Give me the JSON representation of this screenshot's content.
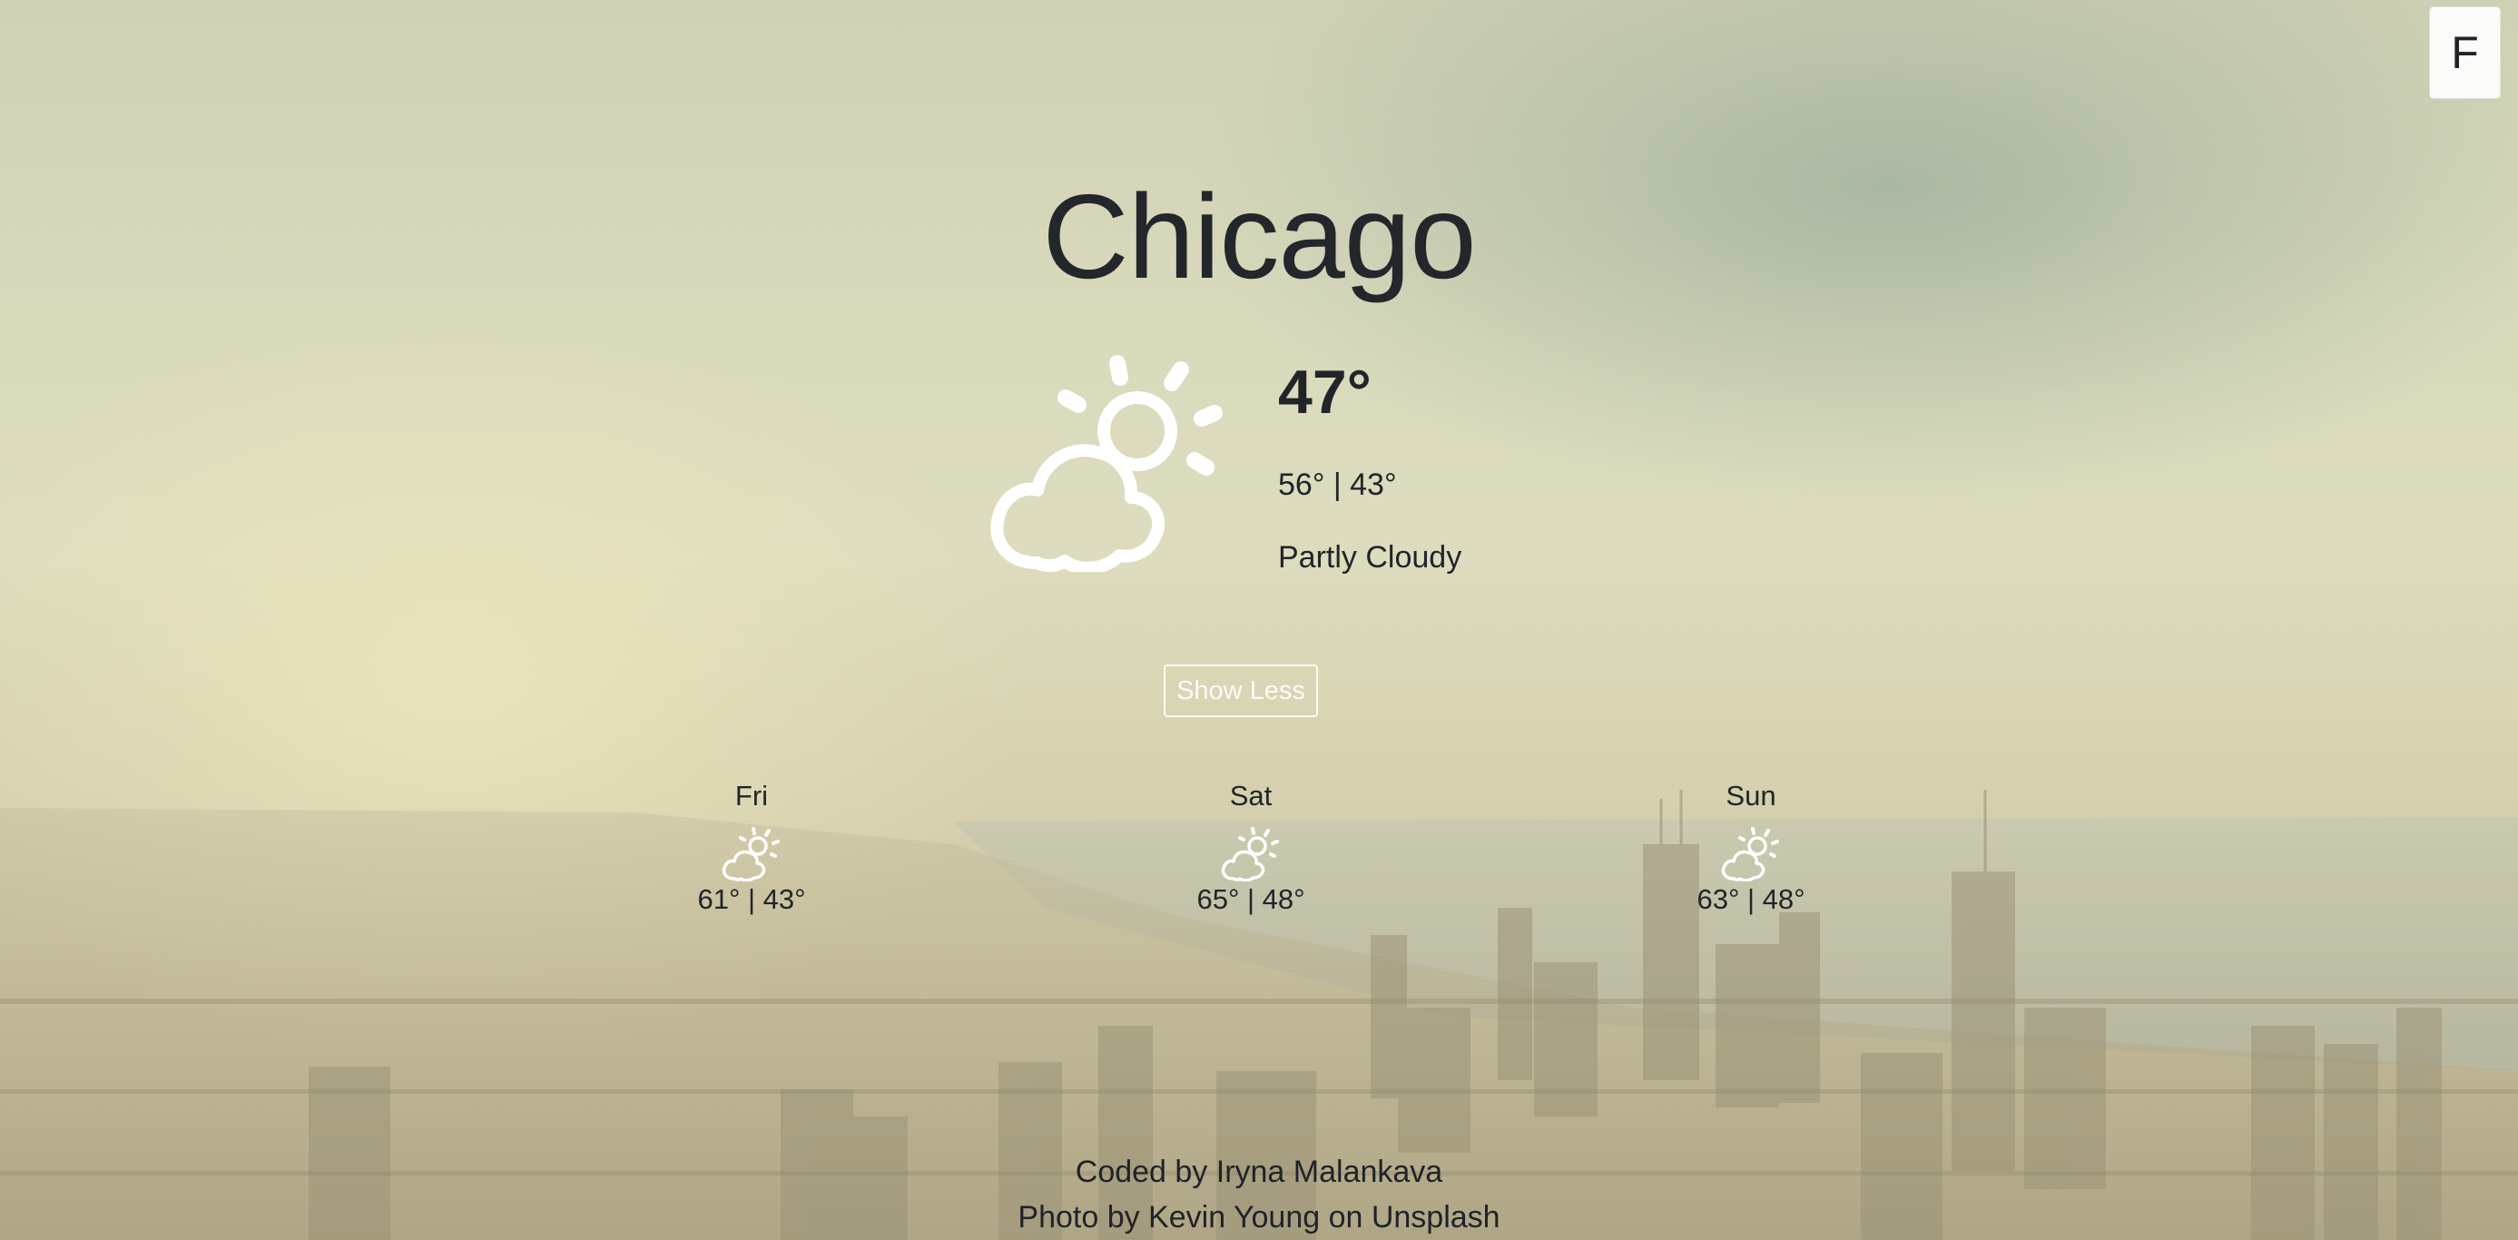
{
  "unit_toggle": {
    "label": "F"
  },
  "current": {
    "city": "Chicago",
    "icon": "partly-cloudy-icon",
    "temperature": "47°",
    "hi_lo": "56° | 43°",
    "description": "Partly Cloudy"
  },
  "toggle_button": {
    "label": "Show Less"
  },
  "forecast": [
    {
      "day": "Fri",
      "icon": "partly-cloudy-icon",
      "range": "61° | 43°"
    },
    {
      "day": "Sat",
      "icon": "partly-cloudy-icon",
      "range": "65° | 48°"
    },
    {
      "day": "Sun",
      "icon": "partly-cloudy-icon",
      "range": "63° | 48°"
    }
  ],
  "footer": {
    "credit_code": "Coded by Iryna Malankava",
    "credit_photo": "Photo by Kevin Young on Unsplash"
  }
}
